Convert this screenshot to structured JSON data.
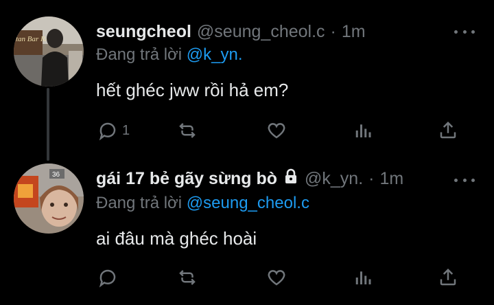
{
  "tweets": [
    {
      "name": "seungcheol",
      "handle": "@seung_cheol.c",
      "separator": "·",
      "time": "1m",
      "replying_prefix": "Đang trả lời ",
      "replying_to": "@k_yn.",
      "text": "hết ghéc jww rồi hả em?",
      "reply_count": "1",
      "locked": false,
      "avatar_sign_text": "tan Bar RAM"
    },
    {
      "name": "gái 17 bẻ gãy sừng bò",
      "handle": "@k_yn.",
      "separator": "·",
      "time": "1m",
      "replying_prefix": "Đang trả lời ",
      "replying_to": "@seung_cheol.c",
      "text": "ai đâu mà ghéc hoài",
      "reply_count": "",
      "locked": true,
      "avatar_sign_text": "36"
    }
  ],
  "icons": {
    "reply": "reply-icon",
    "retweet": "retweet-icon",
    "like": "heart-icon",
    "analytics": "analytics-icon",
    "share": "share-icon",
    "more": "more-icon",
    "lock": "lock-icon"
  },
  "colors": {
    "background": "#000000",
    "text": "#e7e9ea",
    "secondary": "#71767b",
    "link": "#1d9bf0",
    "thread_line": "#333639"
  }
}
